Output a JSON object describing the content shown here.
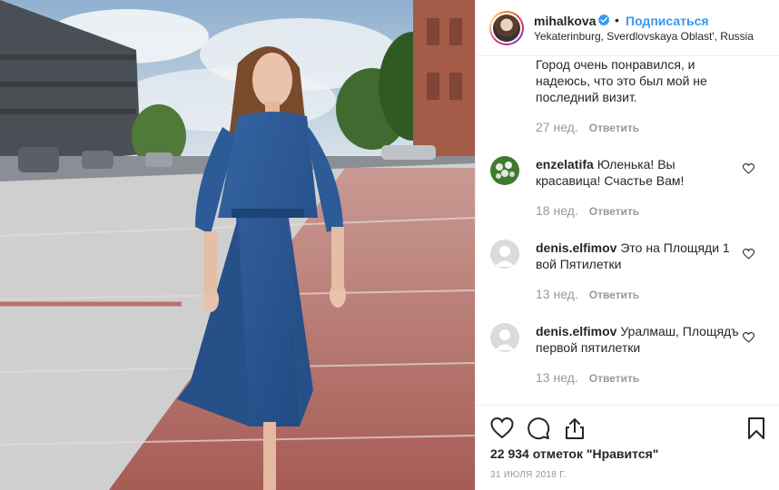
{
  "header": {
    "username": "mihalkova",
    "separator": "•",
    "follow_label": "Подписаться",
    "location": "Yekaterinburg, Sverdlovskaya Oblast', Russia"
  },
  "comments": [
    {
      "user": "",
      "text": "Город очень понравился, и надеюсь, что это был мой не последний визит.",
      "time": "27 нед.",
      "reply": "Ответить",
      "has_avatar": false
    },
    {
      "user": "enzelatifa",
      "text": "Юленька! Вы красавица! Счастье Вам!",
      "time": "18 нед.",
      "reply": "Ответить",
      "has_avatar": true
    },
    {
      "user": "denis.elfimov",
      "text": "Это на Площяди 1 вой Пятилетки",
      "time": "13 нед.",
      "reply": "Ответить",
      "has_avatar": true
    },
    {
      "user": "denis.elfimov",
      "text": "Уралмаш, Площядъ первой пятилетки",
      "time": "13 нед.",
      "reply": "Ответить",
      "has_avatar": true
    }
  ],
  "actions": {
    "likes": "22 934 отметок \"Нравится\"",
    "date": "31 ИЮЛЯ 2018 Г."
  },
  "colors": {
    "link_blue": "#3897f0",
    "verified_blue": "#3897f0",
    "text": "#262626",
    "muted": "#999999"
  },
  "icons": [
    "verified-badge-icon",
    "heart-icon",
    "comment-icon",
    "share-icon",
    "bookmark-icon"
  ]
}
